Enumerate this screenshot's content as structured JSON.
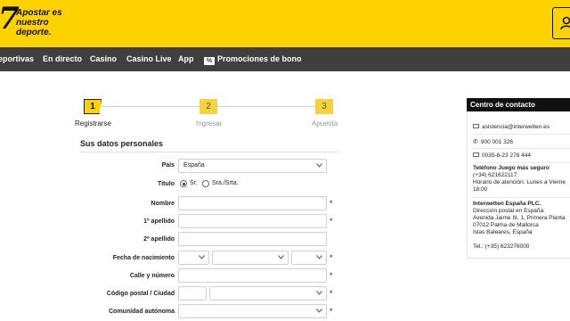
{
  "header": {
    "logo_text": "7",
    "tagline": "Apostar es nuestro deporte.",
    "brand_color": "#ffd200"
  },
  "nav": {
    "items": [
      "eportivas",
      "En directo",
      "Casino",
      "Casino Live",
      "App"
    ],
    "promo_badge": "%",
    "promo_label": "Promociones de bono",
    "background": "#3f3f3f"
  },
  "steps": [
    {
      "number": "1",
      "label": "Registrarse",
      "active": true
    },
    {
      "number": "2",
      "label": "Ingresar",
      "active": false
    },
    {
      "number": "3",
      "label": "Apuesta",
      "active": false
    }
  ],
  "form": {
    "section_title": "Sus datos personales",
    "country_label": "País",
    "country_value": "España",
    "title_label": "Título",
    "title_options": [
      "Sr.",
      "Sra./Srta."
    ],
    "title_selected": "Sr.",
    "name_label": "Nombre",
    "surname1_label": "1º apellido",
    "surname2_label": "2º apellido",
    "birthdate_label": "Fecha de nacimiento",
    "street_label": "Calle y número",
    "postal_label": "Código postal / Ciudad",
    "region_label": "Comunidad autónoma",
    "required_mark": "*"
  },
  "contact": {
    "title": "Centro de contacto",
    "email": "asistencia@interwetten.es",
    "phone": "900 001 326",
    "fax": "0035-6-23 276 444",
    "safe_heading": "Teléfono Juego más seguro",
    "safe_phone": "(+34) 621622117",
    "safe_hours": "Horario de atención: Lunes a Vierne",
    "safe_hours2": "18:00",
    "company": "Interwetten España PLC.",
    "address_intro": "Dirección postal en España:",
    "address_line1": "Avenida Jaime III, 1, Primera Planta",
    "address_line2": "07012 Palma de Mallorca",
    "address_line3": "Islas Baleares, España",
    "tel": "Tel.: (+35) 623276000"
  }
}
